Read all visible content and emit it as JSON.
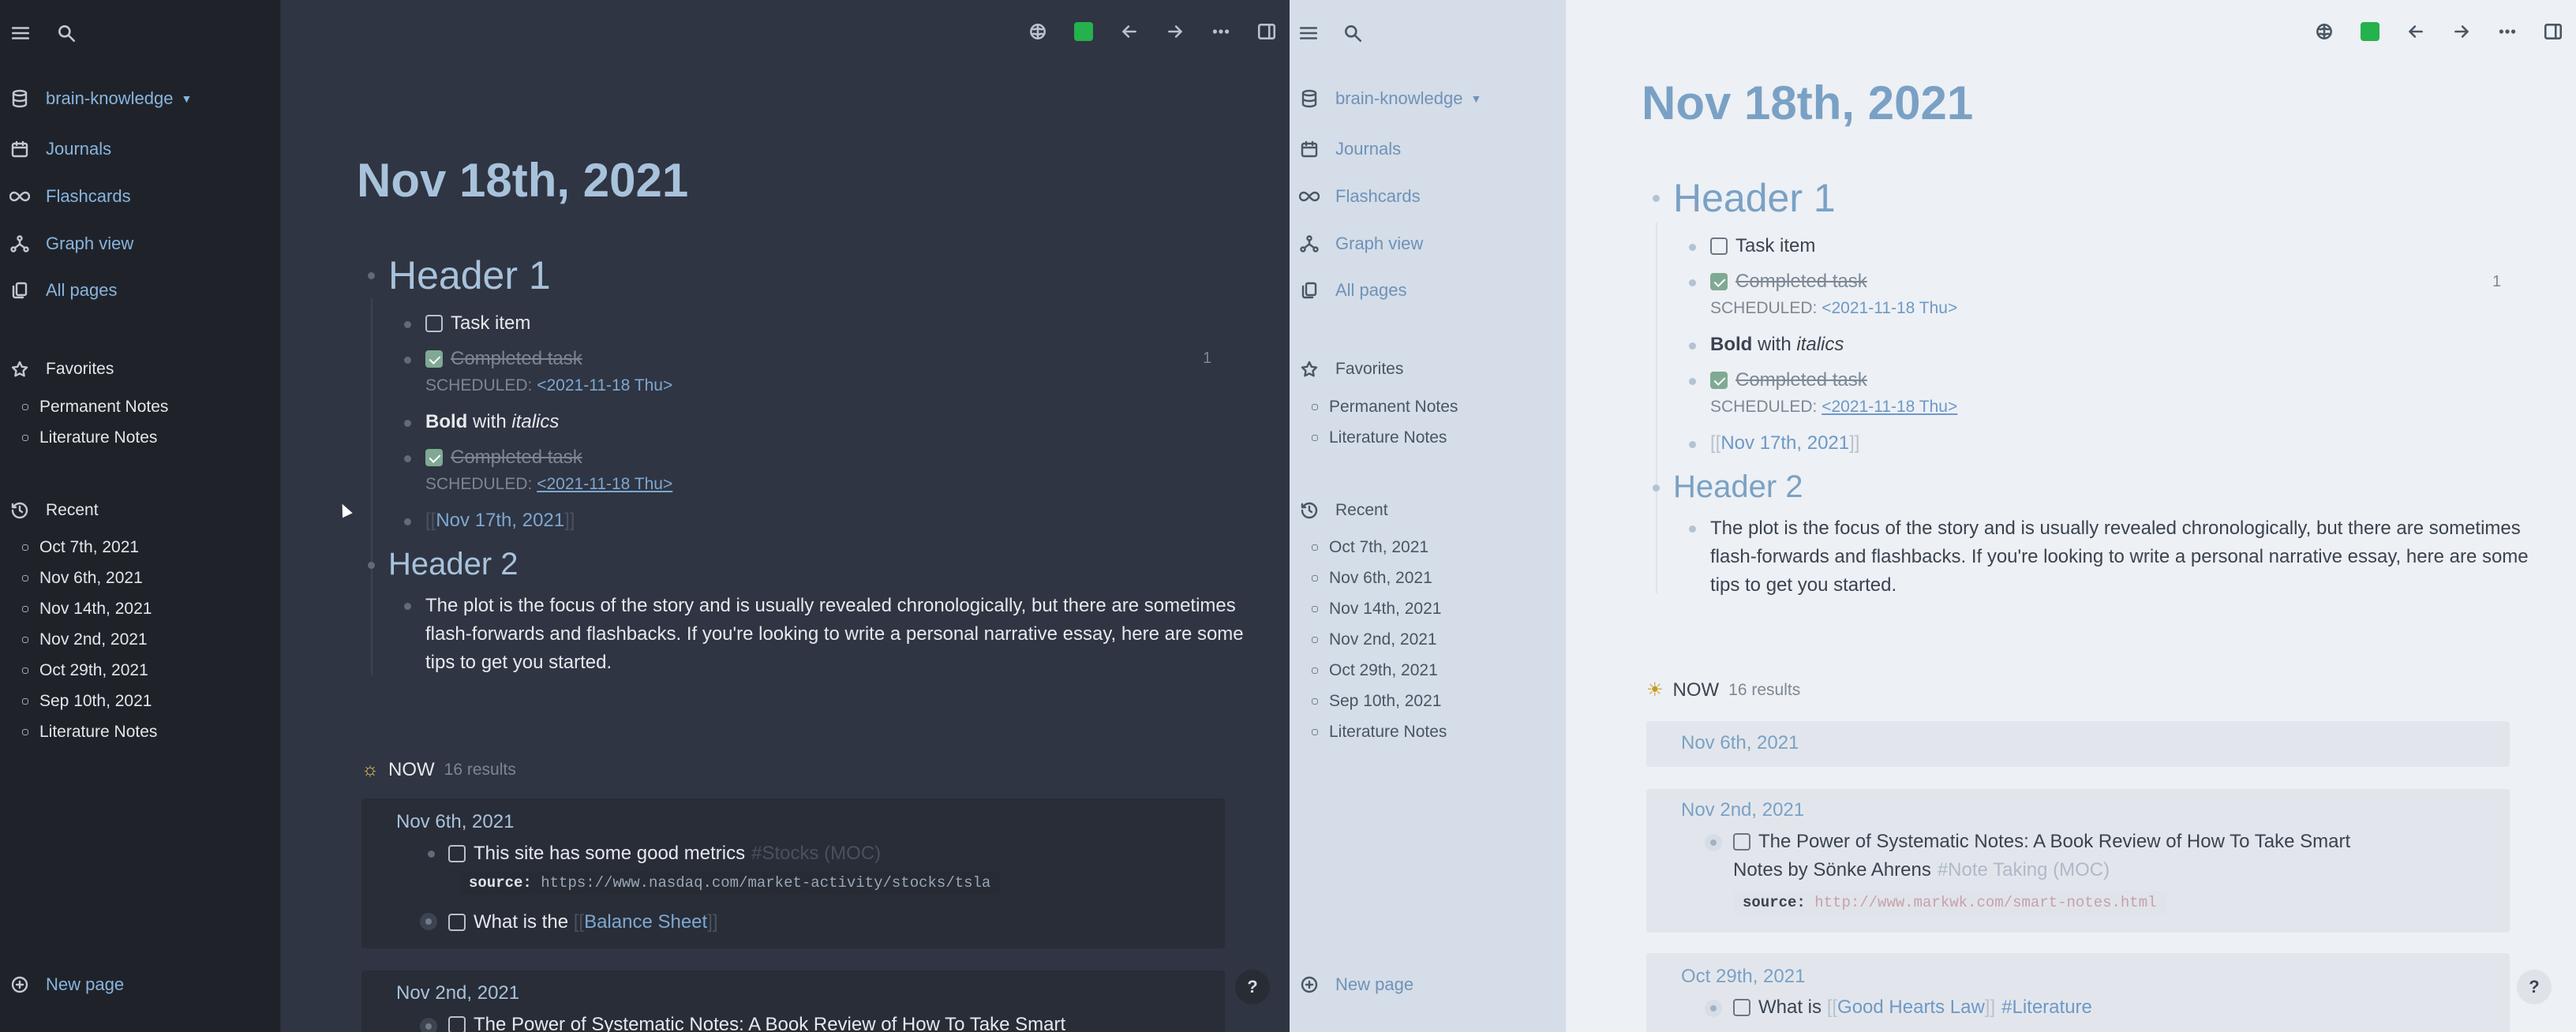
{
  "sidebar": {
    "graph_name": "brain-knowledge",
    "nav": [
      {
        "label": "Journals",
        "icon": "calendar-icon"
      },
      {
        "label": "Flashcards",
        "icon": "infinity-icon"
      },
      {
        "label": "Graph view",
        "icon": "graph-icon"
      },
      {
        "label": "All pages",
        "icon": "pages-icon"
      }
    ],
    "favorites_label": "Favorites",
    "favorites": [
      "Permanent Notes",
      "Literature Notes"
    ],
    "recent_label": "Recent",
    "recent": [
      "Oct 7th, 2021",
      "Nov 6th, 2021",
      "Nov 14th, 2021",
      "Nov 2nd, 2021",
      "Oct 29th, 2021",
      "Sep 10th, 2021",
      "Literature Notes"
    ],
    "new_page": "New page"
  },
  "journal": {
    "title": "Nov 18th, 2021",
    "header1": "Header 1",
    "task_item": "Task item",
    "completed_task": "Completed task",
    "scheduled_prefix": "SCHEDULED:",
    "scheduled_date": "<2021-11-18 Thu>",
    "ref_count": "1",
    "bold_word": "Bold",
    "with_word": "with",
    "italic_word": "italics",
    "bracket_open": "[[",
    "bracket_close": "]]",
    "link_nov17": "Nov 17th, 2021",
    "header2": "Header 2",
    "paragraph": "The plot is the focus of the story and is usually revealed chronologically, but there are sometimes flash-forwards and flashbacks. If you're looking to write a personal narrative essay, here are some tips to get you started."
  },
  "query": {
    "title": "NOW",
    "count": "16 results",
    "dark_groups": {
      "g1_date": "Nov 6th, 2021",
      "g1_item1": "This site has some good metrics",
      "g1_item1_tag": "#Stocks (MOC)",
      "g1_source_key": "source:",
      "g1_source_url": "https://www.nasdaq.com/market-activity/stocks/tsla",
      "g1_item2": "What is the",
      "g1_item2_link": "Balance Sheet",
      "g2_date": "Nov 2nd, 2021",
      "g2_item1": "The Power of Systematic Notes: A Book Review of How To Take Smart"
    },
    "light_groups": {
      "g1_date": "Nov 6th, 2021",
      "g2_date": "Nov 2nd, 2021",
      "g2_item1_line1": "The Power of Systematic Notes: A Book Review of How To Take Smart",
      "g2_item1_line2": "Notes by Sönke Ahrens",
      "g2_item1_tag": "#Note Taking (MOC)",
      "g2_source_key": "source:",
      "g2_source_url": "http://www.markwk.com/smart-notes.html",
      "g3_date": "Oct 29th, 2021",
      "g3_item1": "What is",
      "g3_item1_link": "Good Hearts Law",
      "g3_item1_tag": "#Literature"
    }
  },
  "help_label": "?",
  "colors": {
    "dark_bg": "#2f3542",
    "dark_sidebar": "#1f2329",
    "light_bg": "#edf0f4",
    "light_sidebar": "#d4dde8",
    "accent_green": "#25b14b",
    "heading_blue": "#a8c2db"
  }
}
